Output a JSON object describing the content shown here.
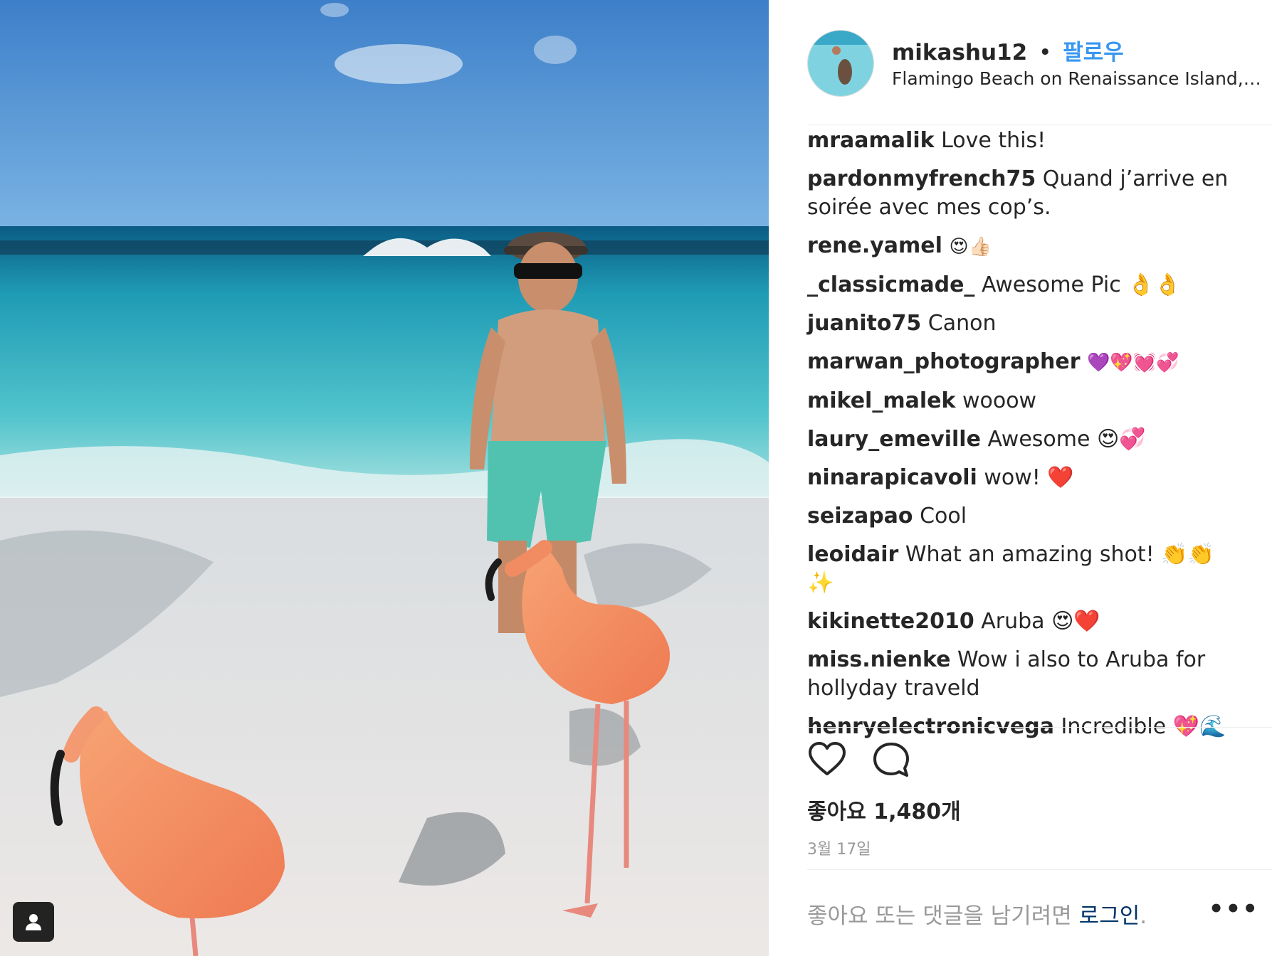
{
  "post": {
    "username": "mikashu12",
    "separator": "•",
    "follow_label": "팔로우",
    "location": "Flamingo Beach on Renaissance Island, Ar..."
  },
  "comments": [
    {
      "user": "mraamalik",
      "text": "Love this!"
    },
    {
      "user": "pardonmyfrench75",
      "text": "Quand j’arrive en soirée avec mes cop’s."
    },
    {
      "user": "rene.yamel",
      "text": "😍👍🏻"
    },
    {
      "user": "_classicmade_",
      "text": "Awesome Pic 👌👌"
    },
    {
      "user": "juanito75",
      "text": "Canon"
    },
    {
      "user": "marwan_photographer",
      "text": "💜💖💓💞"
    },
    {
      "user": "mikel_malek",
      "text": "wooow"
    },
    {
      "user": "laury_emeville",
      "text": "Awesome 😍💞"
    },
    {
      "user": "ninarapicavoli",
      "text": "wow! ❤️"
    },
    {
      "user": "seizapao",
      "text": "Cool"
    },
    {
      "user": "leoidair",
      "text": "What an amazing shot! 👏👏 ✨"
    },
    {
      "user": "kikinette2010",
      "text": "Aruba 😍❤️"
    },
    {
      "user": "miss.nienke",
      "text": "Wow i also to Aruba for hollyday traveld"
    },
    {
      "user": "henryelectronicvega",
      "text": "Incredible 💖🌊"
    }
  ],
  "likes": {
    "label": "좋아요",
    "count": "1,480개"
  },
  "date": "3월 17일",
  "login_prompt": {
    "text": "좋아요 또는 댓글을 남기려면",
    "link": "로그인",
    "suffix": "."
  },
  "more_label": "•••",
  "icons": {
    "like": "heart-icon",
    "comment": "comment-bubble-icon",
    "user_tag": "user-tag-icon",
    "more": "more-options-icon"
  },
  "colors": {
    "follow": "#3897f0",
    "login_link": "#003569",
    "muted": "#999999",
    "text": "#262626"
  }
}
